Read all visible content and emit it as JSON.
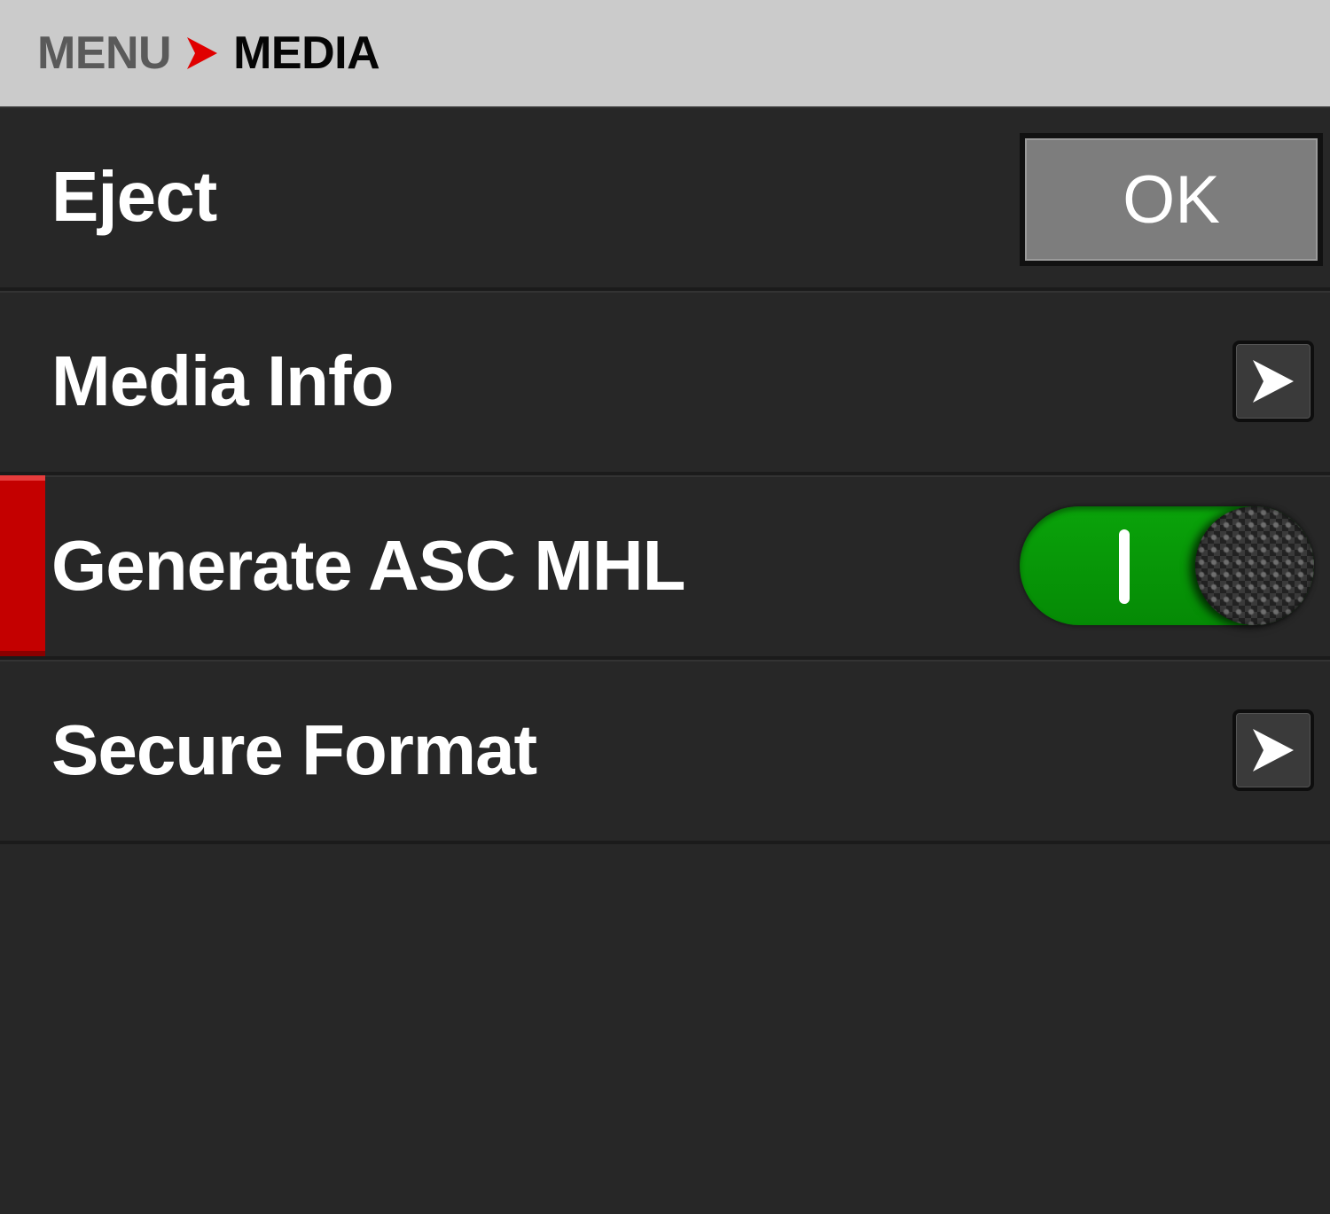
{
  "header": {
    "root_label": "MENU",
    "current_label": "MEDIA",
    "separator_color": "#e00000"
  },
  "items": [
    {
      "label": "Eject",
      "control": "button",
      "button_label": "OK",
      "selected": false
    },
    {
      "label": "Media Info",
      "control": "submenu",
      "selected": false
    },
    {
      "label": "Generate ASC MHL",
      "control": "toggle",
      "toggle_state": "on",
      "selected": true
    },
    {
      "label": "Secure Format",
      "control": "submenu",
      "selected": false
    }
  ],
  "colors": {
    "selected_marker": "#c40000",
    "toggle_on": "#069906"
  }
}
